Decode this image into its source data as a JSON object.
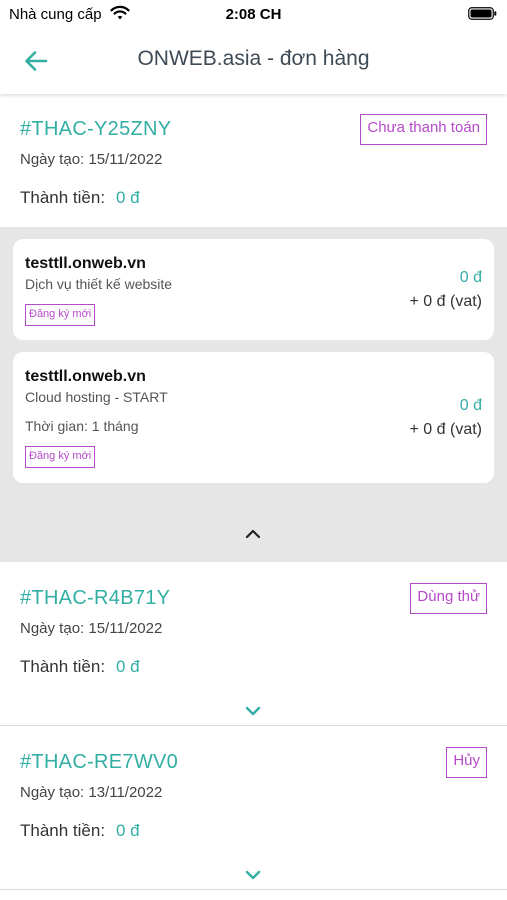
{
  "status_bar": {
    "carrier": "Nhà cung cấp",
    "time": "2:08 CH"
  },
  "nav": {
    "title": "ONWEB.asia - đơn hàng"
  },
  "orders": [
    {
      "id": "#THAC-Y25ZNY",
      "status": "Chưa thanh toán",
      "date": "Ngày tạo: 15/11/2022",
      "total_label": "Thành tiền:",
      "total_value": "0 đ",
      "expanded": true,
      "items": [
        {
          "domain": "testtll.onweb.vn",
          "service": "Dịch vụ thiết kế website",
          "duration": "",
          "tag": "Đăng ký mới",
          "price": "0 đ",
          "vat": "+ 0 đ (vat)"
        },
        {
          "domain": "testtll.onweb.vn",
          "service": "Cloud hosting - START",
          "duration": "Thời gian: 1 tháng",
          "tag": "Đăng ký mới",
          "price": "0 đ",
          "vat": "+ 0 đ (vat)"
        }
      ]
    },
    {
      "id": "#THAC-R4B71Y",
      "status": "Dùng thử",
      "date": "Ngày tạo: 15/11/2022",
      "total_label": "Thành tiền:",
      "total_value": "0 đ",
      "expanded": false
    },
    {
      "id": "#THAC-RE7WV0",
      "status": "Hủy",
      "date": "Ngày tạo: 13/11/2022",
      "total_label": "Thành tiền:",
      "total_value": "0 đ",
      "expanded": false
    }
  ],
  "colors": {
    "accent": "#33aea3",
    "status": "#b64ac9",
    "detail_bg": "#e6e6e6"
  },
  "icons": {
    "back": "arrow-left-icon",
    "collapse": "chevron-up-icon",
    "expand": "chevron-down-icon"
  }
}
